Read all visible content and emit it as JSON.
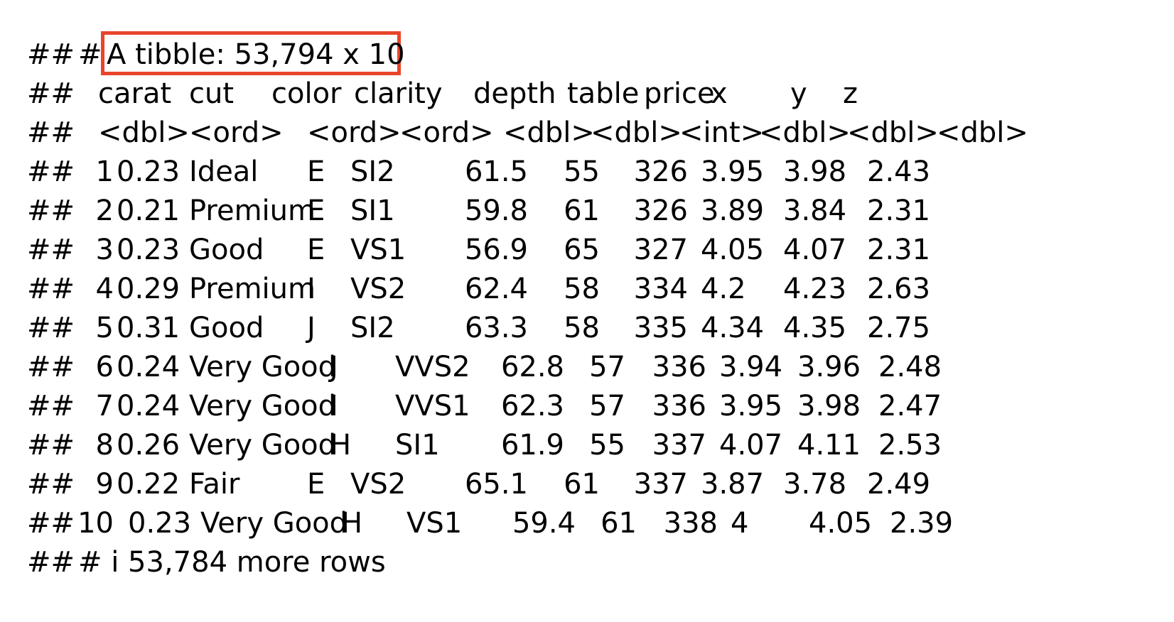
{
  "console": {
    "prefix": "##",
    "header_hash": "#",
    "tibble_label": "A tibble: 53,794 x 10",
    "highlight_color": "#e8452c",
    "columns": [
      {
        "name": "carat",
        "type": "<dbl>"
      },
      {
        "name": "cut",
        "type": "<ord>"
      },
      {
        "name": "color",
        "type": "<ord>"
      },
      {
        "name": "clarity",
        "type": "<ord>"
      },
      {
        "name": "depth",
        "type": "<dbl>"
      },
      {
        "name": "table",
        "type": "<dbl>"
      },
      {
        "name": "price",
        "type": "<int>"
      },
      {
        "name": "x",
        "type": "<dbl>"
      },
      {
        "name": "y",
        "type": "<dbl>"
      },
      {
        "name": "z",
        "type": "<dbl>"
      }
    ],
    "rows": [
      {
        "n": "1",
        "carat": "0.23",
        "cut": "Ideal",
        "color": "E",
        "clarity": "SI2",
        "depth": "61.5",
        "table": "55",
        "price": "326",
        "x": "3.95",
        "y": "3.98",
        "z": "2.43"
      },
      {
        "n": "2",
        "carat": "0.21",
        "cut": "Premium",
        "color": "E",
        "clarity": "SI1",
        "depth": "59.8",
        "table": "61",
        "price": "326",
        "x": "3.89",
        "y": "3.84",
        "z": "2.31"
      },
      {
        "n": "3",
        "carat": "0.23",
        "cut": "Good",
        "color": "E",
        "clarity": "VS1",
        "depth": "56.9",
        "table": "65",
        "price": "327",
        "x": "4.05",
        "y": "4.07",
        "z": "2.31"
      },
      {
        "n": "4",
        "carat": "0.29",
        "cut": "Premium",
        "color": "I",
        "clarity": "VS2",
        "depth": "62.4",
        "table": "58",
        "price": "334",
        "x": "4.2",
        "y": "4.23",
        "z": "2.63"
      },
      {
        "n": "5",
        "carat": "0.31",
        "cut": "Good",
        "color": "J",
        "clarity": "SI2",
        "depth": "63.3",
        "table": "58",
        "price": "335",
        "x": "4.34",
        "y": "4.35",
        "z": "2.75"
      },
      {
        "n": "6",
        "carat": "0.24",
        "cut": "Very Good",
        "color": "J",
        "clarity": "VVS2",
        "depth": "62.8",
        "table": "57",
        "price": "336",
        "x": "3.94",
        "y": "3.96",
        "z": "2.48"
      },
      {
        "n": "7",
        "carat": "0.24",
        "cut": "Very Good",
        "color": "I",
        "clarity": "VVS1",
        "depth": "62.3",
        "table": "57",
        "price": "336",
        "x": "3.95",
        "y": "3.98",
        "z": "2.47"
      },
      {
        "n": "8",
        "carat": "0.26",
        "cut": "Very Good",
        "color": "H",
        "clarity": "SI1",
        "depth": "61.9",
        "table": "55",
        "price": "337",
        "x": "4.07",
        "y": "4.11",
        "z": "2.53"
      },
      {
        "n": "9",
        "carat": "0.22",
        "cut": "Fair",
        "color": "E",
        "clarity": "VS2",
        "depth": "65.1",
        "table": "61",
        "price": "337",
        "x": "3.87",
        "y": "3.78",
        "z": "2.49"
      },
      {
        "n": "10",
        "carat": "0.23",
        "cut": "Very Good",
        "color": "H",
        "clarity": "VS1",
        "depth": "59.4",
        "table": "61",
        "price": "338",
        "x": "4",
        "y": "4.05",
        "z": "2.39"
      }
    ],
    "footer": "# i 53,784 more rows"
  }
}
